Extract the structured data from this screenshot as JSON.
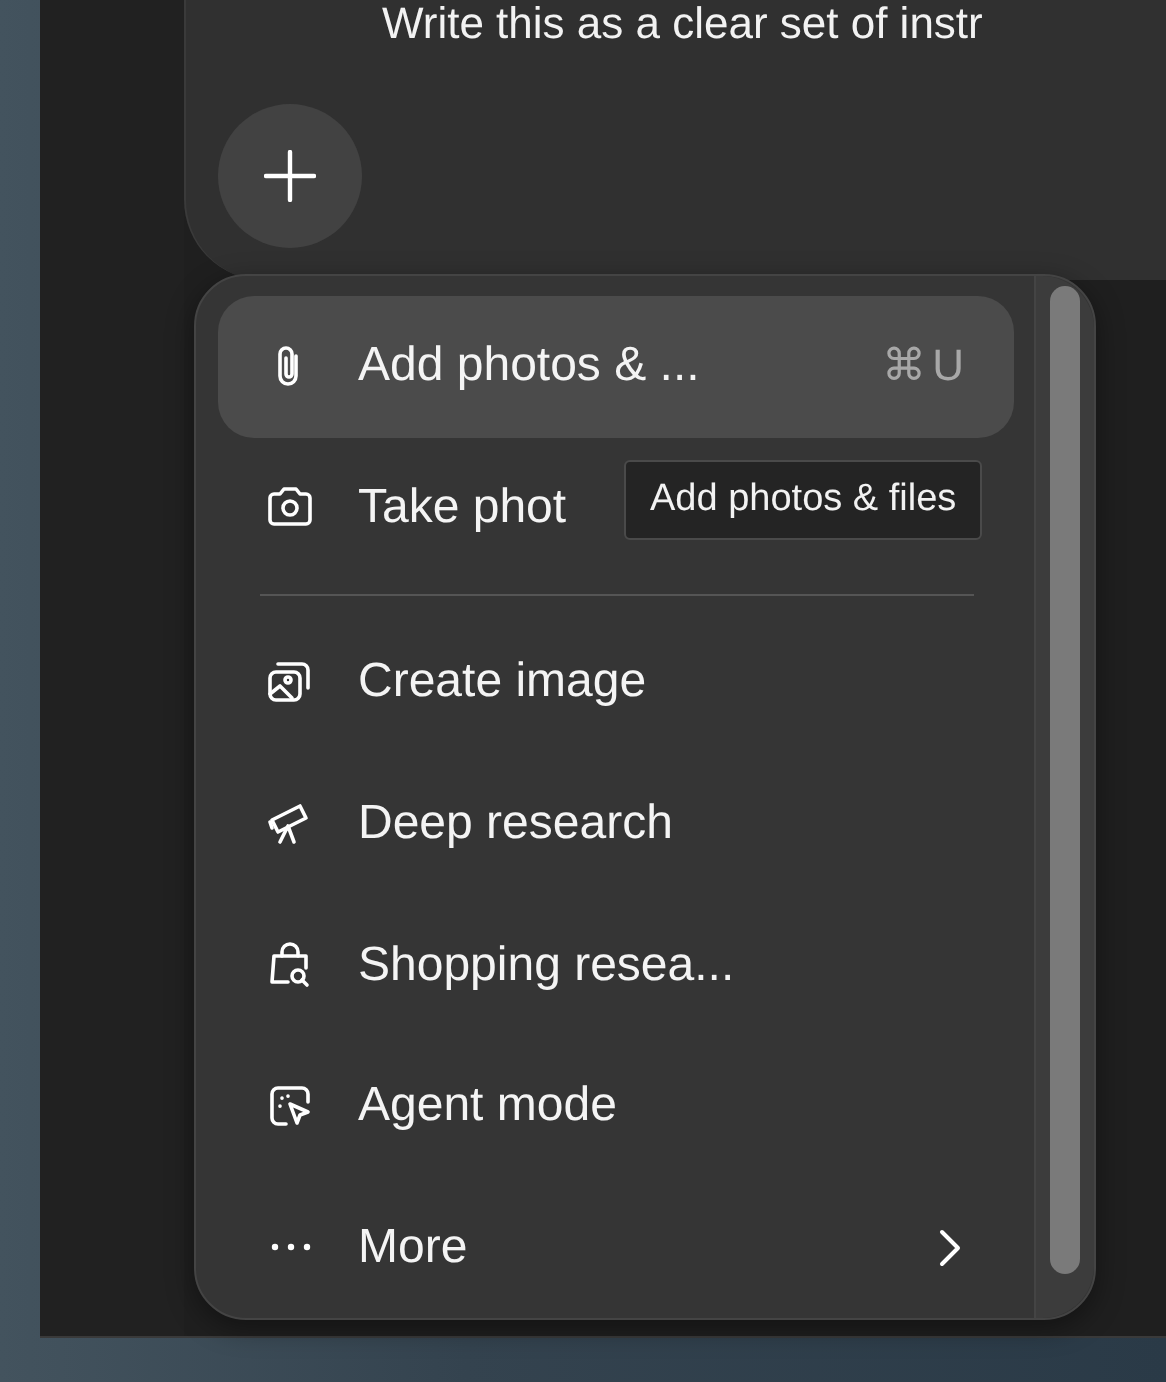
{
  "composer": {
    "text": "Write this as a clear set of instr"
  },
  "menu": {
    "items": [
      {
        "kind": "action",
        "label": "Add photos & ...",
        "shortcut": "⌘U",
        "selected": true
      },
      {
        "kind": "action",
        "label": "Take phot",
        "selected": false
      },
      {
        "kind": "separator"
      },
      {
        "kind": "action",
        "label": "Create image",
        "selected": false
      },
      {
        "kind": "action",
        "label": "Deep research",
        "selected": false
      },
      {
        "kind": "action",
        "label": "Shopping resea...",
        "selected": false
      },
      {
        "kind": "action",
        "label": "Agent mode",
        "selected": false
      },
      {
        "kind": "submenu",
        "label": "More",
        "selected": false
      }
    ]
  },
  "tooltip": {
    "text": "Add photos & files"
  }
}
